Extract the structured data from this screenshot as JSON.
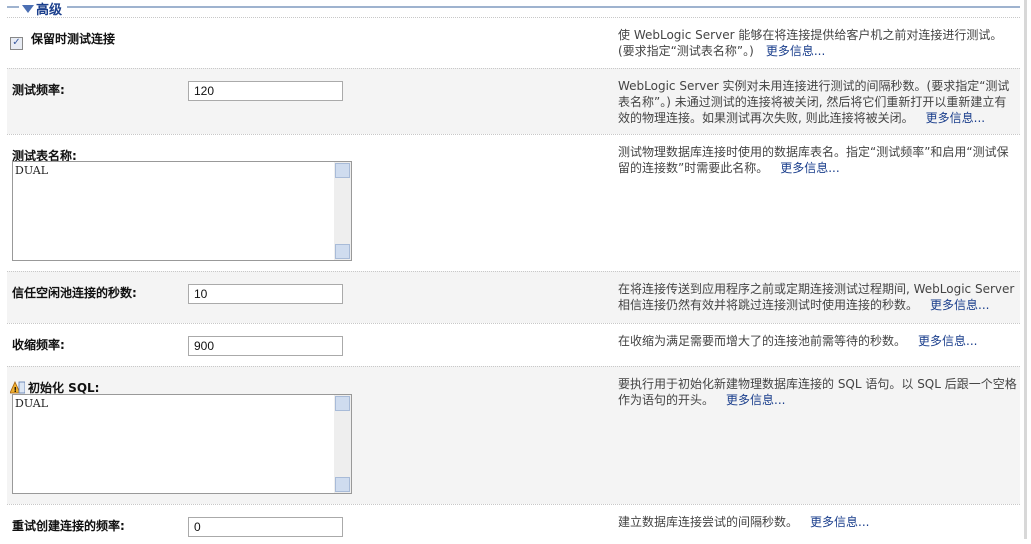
{
  "section_title": "高级",
  "more_link": "更多信息...",
  "rows": [
    {
      "label": "保留时测试连接",
      "checked": true,
      "desc": "使 WebLogic Server 能够在将连接提供给客户机之前对连接进行测试。(要求指定“测试表名称”。)"
    },
    {
      "label": "测试频率:",
      "value": "120",
      "desc": "WebLogic Server 实例对未用连接进行测试的间隔秒数。(要求指定“测试表名称”。) 未通过测试的连接将被关闭, 然后将它们重新打开以重新建立有效的物理连接。如果测试再次失败, 则此连接将被关闭。"
    },
    {
      "label": "测试表名称:",
      "value": "DUAL",
      "desc": "测试物理数据库连接时使用的数据库表名。指定“测试频率”和启用“测试保留的连接数”时需要此名称。"
    },
    {
      "label": "信任空闲池连接的秒数:",
      "value": "10",
      "desc": "在将连接传送到应用程序之前或定期连接测试过程期间, WebLogic Server 相信连接仍然有效并将跳过连接测试时使用连接的秒数。"
    },
    {
      "label": "收缩频率:",
      "value": "900",
      "desc": "在收缩为满足需要而增大了的连接池前需等待的秒数。"
    },
    {
      "label": "初始化 SQL:",
      "value": "DUAL",
      "desc": "要执行用于初始化新建物理数据库连接的 SQL 语句。以 SQL 后跟一个空格作为语句的开头。"
    },
    {
      "label": "重试创建连接的频率:",
      "value": "0",
      "desc": "建立数据库连接尝试的间隔秒数。"
    }
  ]
}
